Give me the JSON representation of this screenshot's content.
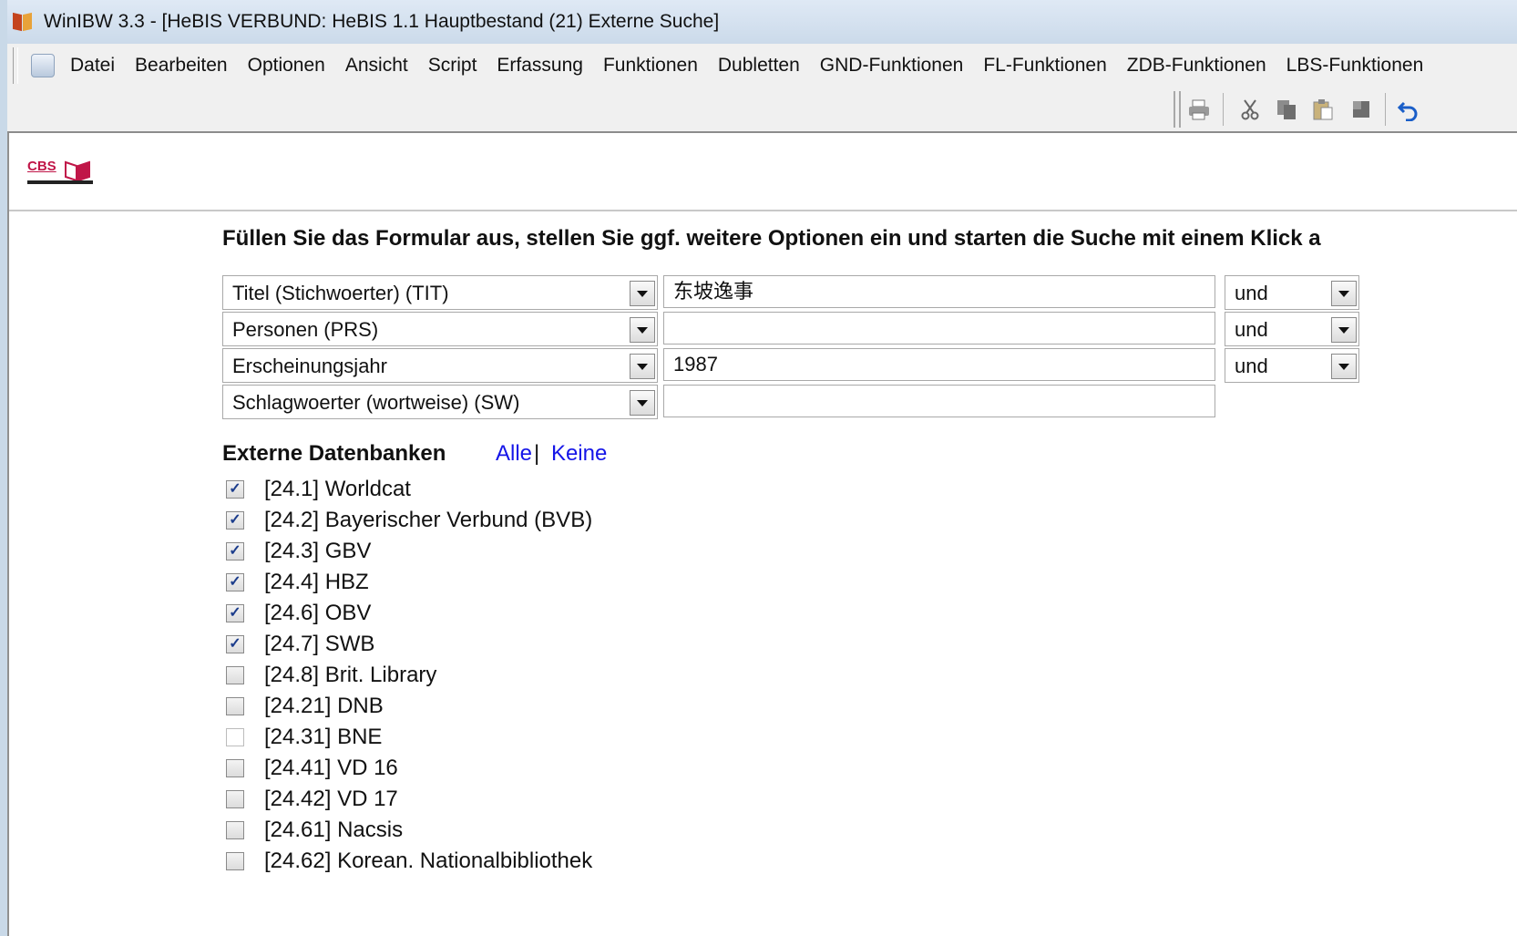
{
  "window": {
    "title": "WinIBW 3.3 - [HeBIS VERBUND: HeBIS 1.1 Hauptbestand (21) Externe Suche]"
  },
  "menu": {
    "items": [
      "Datei",
      "Bearbeiten",
      "Optionen",
      "Ansicht",
      "Script",
      "Erfassung",
      "Funktionen",
      "Dubletten",
      "GND-Funktionen",
      "FL-Funktionen",
      "ZDB-Funktionen",
      "LBS-Funktionen"
    ]
  },
  "toolbar": {
    "icons": [
      "print-icon",
      "cut-icon",
      "copy-icon",
      "paste-icon",
      "stop-icon",
      "undo-icon"
    ]
  },
  "logo": {
    "text": "CBS"
  },
  "form": {
    "instruction": "Füllen Sie das Formular aus, stellen Sie ggf. weitere Optionen ein und starten die Suche mit einem Klick a",
    "rows": [
      {
        "field": "Titel (Stichwoerter) (TIT)",
        "value": "东坡逸事",
        "operator": "und"
      },
      {
        "field": "Personen (PRS)",
        "value": "",
        "operator": "und"
      },
      {
        "field": "Erscheinungsjahr",
        "value": "1987",
        "operator": "und"
      },
      {
        "field": "Schlagwoerter (wortweise) (SW)",
        "value": ""
      }
    ]
  },
  "databases": {
    "heading": "Externe Datenbanken",
    "all_label": "Alle",
    "separator": "|",
    "none_label": "Keine",
    "items": [
      {
        "label": "[24.1] Worldcat",
        "checked": true
      },
      {
        "label": "[24.2] Bayerischer Verbund (BVB)",
        "checked": true
      },
      {
        "label": "[24.3] GBV",
        "checked": true
      },
      {
        "label": "[24.4] HBZ",
        "checked": true
      },
      {
        "label": "[24.6] OBV",
        "checked": true
      },
      {
        "label": "[24.7] SWB",
        "checked": true
      },
      {
        "label": "[24.8] Brit. Library",
        "checked": false
      },
      {
        "label": "[24.21] DNB",
        "checked": false
      },
      {
        "label": "[24.31] BNE",
        "checked": false
      },
      {
        "label": "[24.41] VD 16",
        "checked": false
      },
      {
        "label": "[24.42] VD 17",
        "checked": false
      },
      {
        "label": "[24.61] Nacsis",
        "checked": false
      },
      {
        "label": "[24.62] Korean. Nationalbibliothek",
        "checked": false
      }
    ]
  }
}
